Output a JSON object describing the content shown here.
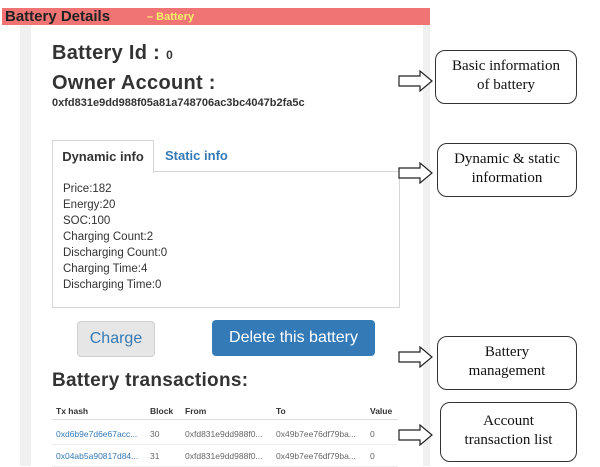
{
  "titlebar": {
    "title": "Battery Details",
    "subtitle": "– Battery"
  },
  "battery": {
    "id_label": "Battery Id :",
    "id_value": "0",
    "owner_label": "Owner Account :",
    "owner_address": "0xfd831e9dd988f05a81a748706ac3bc4047b2fa5c"
  },
  "tabs": {
    "dynamic": "Dynamic info",
    "static": "Static info"
  },
  "dynamic_info": [
    "Price:182",
    "Energy:20",
    "SOC:100",
    "Charging Count:2",
    "Discharging Count:0",
    "Charging Time:4",
    "Discharging Time:0"
  ],
  "buttons": {
    "charge": "Charge",
    "delete": "Delete this battery"
  },
  "transactions": {
    "title": "Battery transactions:",
    "headers": [
      "Tx hash",
      "Block",
      "From",
      "To",
      "Value"
    ],
    "rows": [
      [
        "0xd6b9e7d6e67acc...",
        "30",
        "0xfd831e9dd988f0...",
        "0x49b7ee76df79ba...",
        "0"
      ],
      [
        "0x04ab5a90817d84...",
        "31",
        "0xfd831e9dd988f0...",
        "0x49b7ee76df79ba...",
        "0"
      ]
    ]
  },
  "annotations": {
    "basic": [
      "Basic information",
      "of battery"
    ],
    "dynamic_static": [
      "Dynamic & static",
      "information"
    ],
    "management": [
      "Battery",
      "management"
    ],
    "tx_list": [
      "Account",
      "transaction list"
    ]
  }
}
